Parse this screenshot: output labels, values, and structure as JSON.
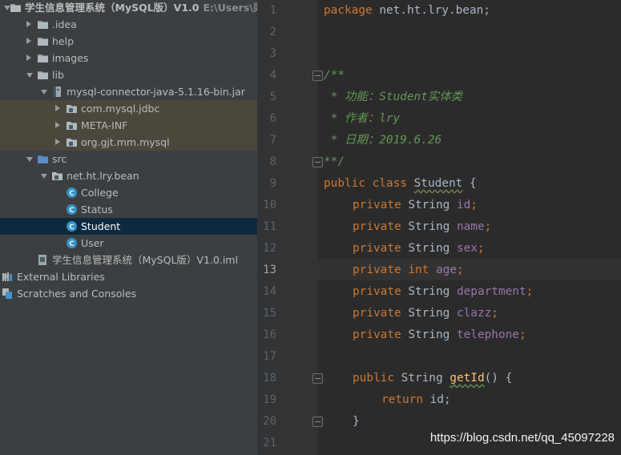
{
  "tree": {
    "project_name": "学生信息管理系统（MySQL版）V1.0",
    "project_path": "E:\\Users\\梁\\学",
    "items": [
      {
        "label": "学生信息管理系统（MySQL版）V1.0",
        "depth": 0,
        "arrow": "down",
        "icon": "folder-icon"
      },
      {
        "label": ".idea",
        "depth": 1,
        "arrow": "right",
        "icon": "folder-icon"
      },
      {
        "label": "help",
        "depth": 1,
        "arrow": "right",
        "icon": "folder-icon"
      },
      {
        "label": "images",
        "depth": 1,
        "arrow": "right",
        "icon": "folder-icon"
      },
      {
        "label": "lib",
        "depth": 1,
        "arrow": "down",
        "icon": "folder-icon"
      },
      {
        "label": "mysql-connector-java-5.1.16-bin.jar",
        "depth": 2,
        "arrow": "down",
        "icon": "jar-icon"
      },
      {
        "label": "com.mysql.jdbc",
        "depth": 3,
        "arrow": "right",
        "icon": "package-icon"
      },
      {
        "label": "META-INF",
        "depth": 3,
        "arrow": "right",
        "icon": "package-icon"
      },
      {
        "label": "org.gjt.mm.mysql",
        "depth": 3,
        "arrow": "right",
        "icon": "package-icon"
      },
      {
        "label": "src",
        "depth": 1,
        "arrow": "down",
        "icon": "source-folder-icon"
      },
      {
        "label": "net.ht.lry.bean",
        "depth": 2,
        "arrow": "down",
        "icon": "package-icon"
      },
      {
        "label": "College",
        "depth": 3,
        "arrow": "none",
        "icon": "class-icon"
      },
      {
        "label": "Status",
        "depth": 3,
        "arrow": "none",
        "icon": "class-icon"
      },
      {
        "label": "Student",
        "depth": 3,
        "arrow": "none",
        "icon": "class-icon"
      },
      {
        "label": "User",
        "depth": 3,
        "arrow": "none",
        "icon": "class-icon"
      },
      {
        "label": "学生信息管理系统（MySQL版）V1.0.iml",
        "depth": 1,
        "arrow": "none",
        "icon": "iml-file-icon"
      },
      {
        "label": "External Libraries",
        "depth": 0,
        "arrow": "right",
        "icon": "library-icon"
      },
      {
        "label": "Scratches and Consoles",
        "depth": 0,
        "arrow": "none",
        "icon": "scratches-icon"
      }
    ],
    "selected": "Student"
  },
  "editor": {
    "current_line": 13,
    "line_numbers": [
      "1",
      "2",
      "3",
      "4",
      "5",
      "6",
      "7",
      "8",
      "9",
      "10",
      "11",
      "12",
      "13",
      "14",
      "15",
      "16",
      "17",
      "18",
      "19",
      "20",
      "21"
    ],
    "code": {
      "l1_package": "package",
      "l1_name": " net.ht.lry.bean;",
      "l4_comment": "/**",
      "l5_comment": " * 功能：Student实体类",
      "l6_comment": " * 作者：lry",
      "l7_comment": " * 日期：2019.6.26",
      "l8_comment": "**/",
      "l9_public": "public",
      "l9_class": " class ",
      "l9_name": "Student",
      "l9_brace": " {",
      "private": "private",
      "int": "int",
      "type_string": " String ",
      "f_id": "id",
      "f_name": "name",
      "f_sex": "sex",
      "f_age": "age",
      "f_department": "department",
      "f_clazz": "clazz",
      "f_telephone": "telephone",
      "semicolon": ";",
      "l18_public": "public",
      "l18_type": " String ",
      "l18_method": "getId",
      "l18_rest": "() {",
      "l19_return": "return",
      "l19_rest": " id;",
      "l20_brace": "}"
    }
  },
  "watermark": "https://blog.csdn.net/qq_45097228"
}
